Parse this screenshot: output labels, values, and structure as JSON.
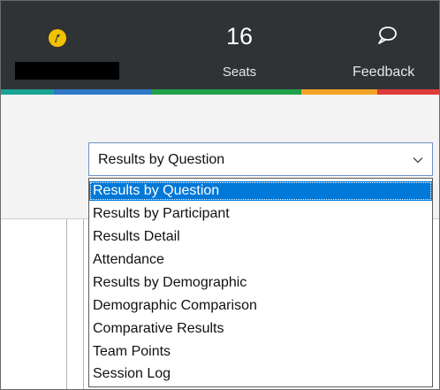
{
  "header": {
    "seats_count": "16",
    "seats_label": "Seats",
    "feedback_label": "Feedback",
    "brand_icon": "logo-icon",
    "feedback_icon": "speech-bubble-icon",
    "brand_color": "#f2c200"
  },
  "stripe_colors": [
    "#18a394",
    "#2e77c9",
    "#1fa04b",
    "#f1a226",
    "#e03a3a"
  ],
  "report_select": {
    "value": "Results by Question",
    "options": [
      "Results by Question",
      "Results by Participant",
      "Results Detail",
      "Attendance",
      "Results by Demographic",
      "Demographic Comparison",
      "Comparative Results",
      "Team Points",
      "Session Log"
    ],
    "selected_index": 0
  }
}
